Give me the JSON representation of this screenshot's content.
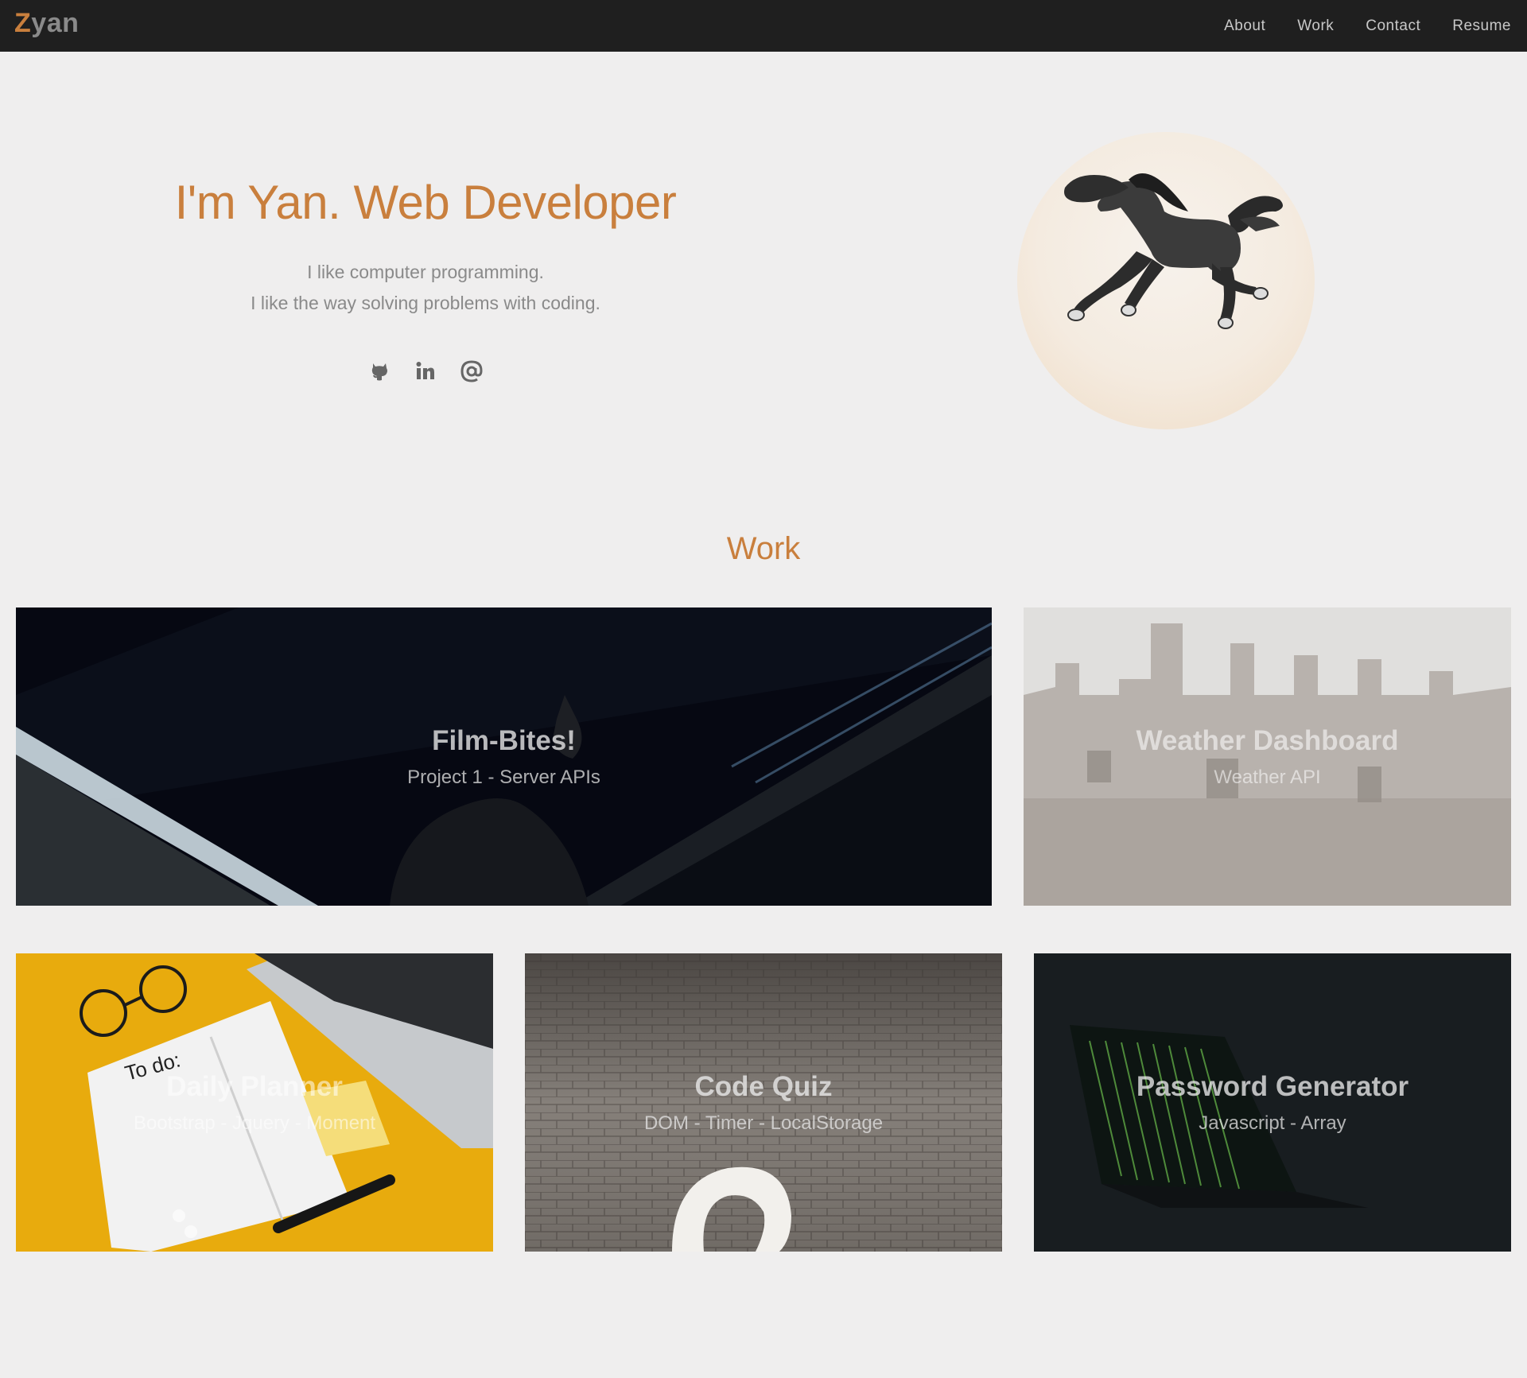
{
  "nav": {
    "brand_initial": "Z",
    "brand_rest": "yan",
    "links": [
      "About",
      "Work",
      "Contact",
      "Resume"
    ]
  },
  "hero": {
    "title": "I'm Yan. Web Developer",
    "lines": [
      "I like computer programming.",
      "I like the way solving problems with coding."
    ],
    "socials": [
      "github-icon",
      "linkedin-icon",
      "email-at-icon"
    ]
  },
  "work": {
    "heading": "Work",
    "projects": [
      {
        "title": "Film-Bites!",
        "subtitle": "Project 1 - Server APIs"
      },
      {
        "title": "Weather Dashboard",
        "subtitle": "Weather API"
      },
      {
        "title": "Daily Planner",
        "subtitle": "Bootstrap - Jquery - Moment"
      },
      {
        "title": "Code Quiz",
        "subtitle": "DOM - Timer - LocalStorage"
      },
      {
        "title": "Password Generator",
        "subtitle": "Javascript - Array"
      }
    ]
  },
  "colors": {
    "accent": "#c97f3d",
    "nav_bg": "#1f1f1f",
    "page_bg": "#efeeee"
  }
}
